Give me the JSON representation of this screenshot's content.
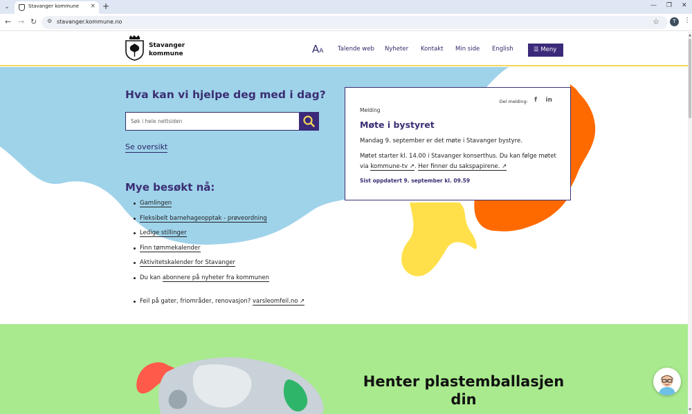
{
  "browser": {
    "tab_title": "Stavanger kommune",
    "url": "stavanger.kommune.no",
    "profile_initial": "T"
  },
  "header": {
    "logo_line1": "Stavanger",
    "logo_line2": "kommune",
    "font_size_label_big": "A",
    "font_size_label_small": "A",
    "nav": [
      "Talende web",
      "Nyheter",
      "Kontakt",
      "Min side",
      "English"
    ],
    "menu_label": "Meny"
  },
  "hero": {
    "title": "Hva kan vi hjelpe deg med i dag?",
    "search_placeholder": "Søk i hele nettsiden",
    "see_overview": "Se oversikt",
    "popular_title": "Mye besøkt nå:",
    "popular_links": [
      "Gamlingen",
      "Fleksibelt barnehageopptak - prøveordning",
      "Ledige stillinger",
      "Finn tømmekalender",
      "Aktivitetskalender for Stavanger"
    ],
    "subscribe_prefix": "Du kan ",
    "subscribe_link": "abonnere på nyheter fra kommunen",
    "error_prefix": "Feil på gater, friområder, renovasjon? ",
    "error_link": "varsleomfeil.no"
  },
  "notice": {
    "share_label": "Del melding:",
    "kicker": "Melding",
    "title": "Møte i bystyret",
    "p1": "Mandag 9. september er det møte i Stavanger bystyre.",
    "p2_text": "Møtet starter kl. 14.00 i Stavanger konserthus. Du kan følge møtet via ",
    "p2_link1": "kommune-tv",
    "p2_sep": ". ",
    "p2_link2": "Her finner du sakspapirene.",
    "updated": "Sist oppdatert 9. september kl. 09.59"
  },
  "green": {
    "heading": "Henter plastemballasjen din"
  },
  "colors": {
    "brand_purple": "#3b2a7a",
    "hero_blue": "#9fd3ea",
    "orange_blob": "#ff6a00",
    "yellow_blob": "#ffe04a",
    "green_section": "#a9ea8e",
    "header_underline": "#f3d75a"
  },
  "icons": {
    "search": "magnifier-icon",
    "facebook": "facebook-icon",
    "linkedin": "linkedin-icon",
    "menu": "hamburger-icon",
    "external": "arrow-up-right-icon"
  }
}
